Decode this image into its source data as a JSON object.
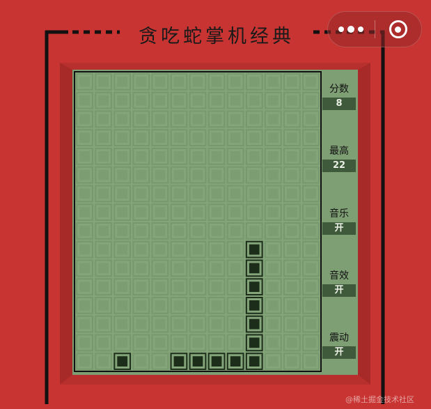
{
  "app": {
    "title": "贪吃蛇掌机经典"
  },
  "capsule": {
    "more_icon": "more-dots-icon",
    "close_icon": "close-target-icon"
  },
  "board": {
    "cols": 13,
    "rows": 16,
    "snake": [
      [
        9,
        9
      ],
      [
        9,
        10
      ],
      [
        9,
        11
      ],
      [
        9,
        12
      ],
      [
        9,
        13
      ],
      [
        9,
        14
      ],
      [
        9,
        15
      ],
      [
        8,
        15
      ],
      [
        7,
        15
      ],
      [
        6,
        15
      ],
      [
        5,
        15
      ]
    ],
    "food": [
      2,
      15
    ]
  },
  "sidebar": {
    "score": {
      "label": "分数",
      "value": "8"
    },
    "best": {
      "label": "最高",
      "value": "22"
    },
    "music": {
      "label": "音乐",
      "value": "开"
    },
    "sound": {
      "label": "音效",
      "value": "开"
    },
    "vibrate": {
      "label": "震动",
      "value": "开"
    }
  },
  "watermark": "@稀土掘金技术社区",
  "colors": {
    "body": "#c73432",
    "screen": "#84a47a",
    "cell": "#7a9a70",
    "snake": "#1c2e1a",
    "value_bg": "#3f5a3b"
  }
}
